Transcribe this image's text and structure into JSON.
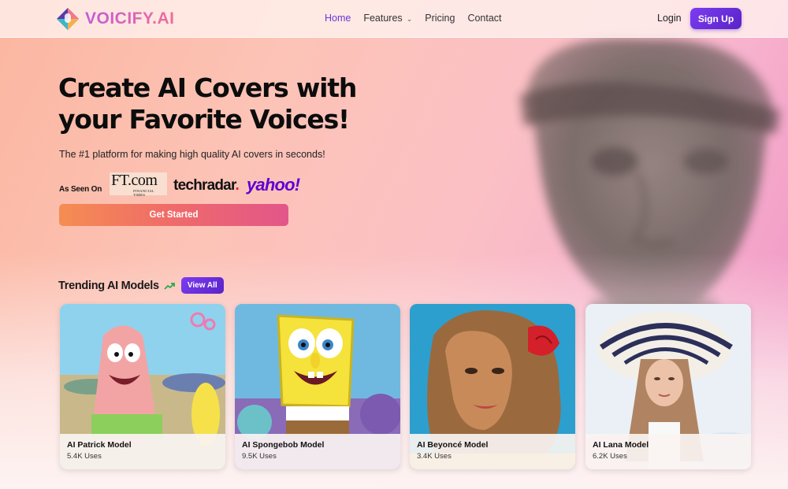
{
  "brand": {
    "name": "VOICIFY.AI"
  },
  "nav": {
    "links": [
      {
        "label": "Home",
        "active": true
      },
      {
        "label": "Features",
        "dropdown": true
      },
      {
        "label": "Pricing"
      },
      {
        "label": "Contact"
      }
    ],
    "login_label": "Login",
    "signup_label": "Sign Up"
  },
  "hero": {
    "title": "Create AI Covers with your Favorite Voices!",
    "subtitle": "The #1 platform for making high quality AI covers in seconds!",
    "as_seen_on_label": "As Seen On",
    "press": {
      "ft_main": "FT.com",
      "ft_sub": "FINANCIAL TIMES",
      "techradar": "techradar",
      "techradar_dot": ".",
      "yahoo": "yahoo!"
    },
    "cta_label": "Get Started"
  },
  "trending": {
    "title": "Trending AI Models",
    "view_all_label": "View All",
    "cards": [
      {
        "name": "AI Patrick Model",
        "uses": "5.4K Uses"
      },
      {
        "name": "AI Spongebob Model",
        "uses": "9.5K Uses"
      },
      {
        "name": "AI Beyoncé Model",
        "uses": "3.4K Uses"
      },
      {
        "name": "AI Lana Model",
        "uses": "6.2K Uses"
      }
    ]
  },
  "colors": {
    "accent": "#6b35d9",
    "button_purple": "#7b3cf0",
    "cta_gradient": [
      "#f58d52",
      "#e2568a"
    ]
  },
  "icons": [
    "logo-icon",
    "chevron-down-icon",
    "trending-up-icon"
  ]
}
